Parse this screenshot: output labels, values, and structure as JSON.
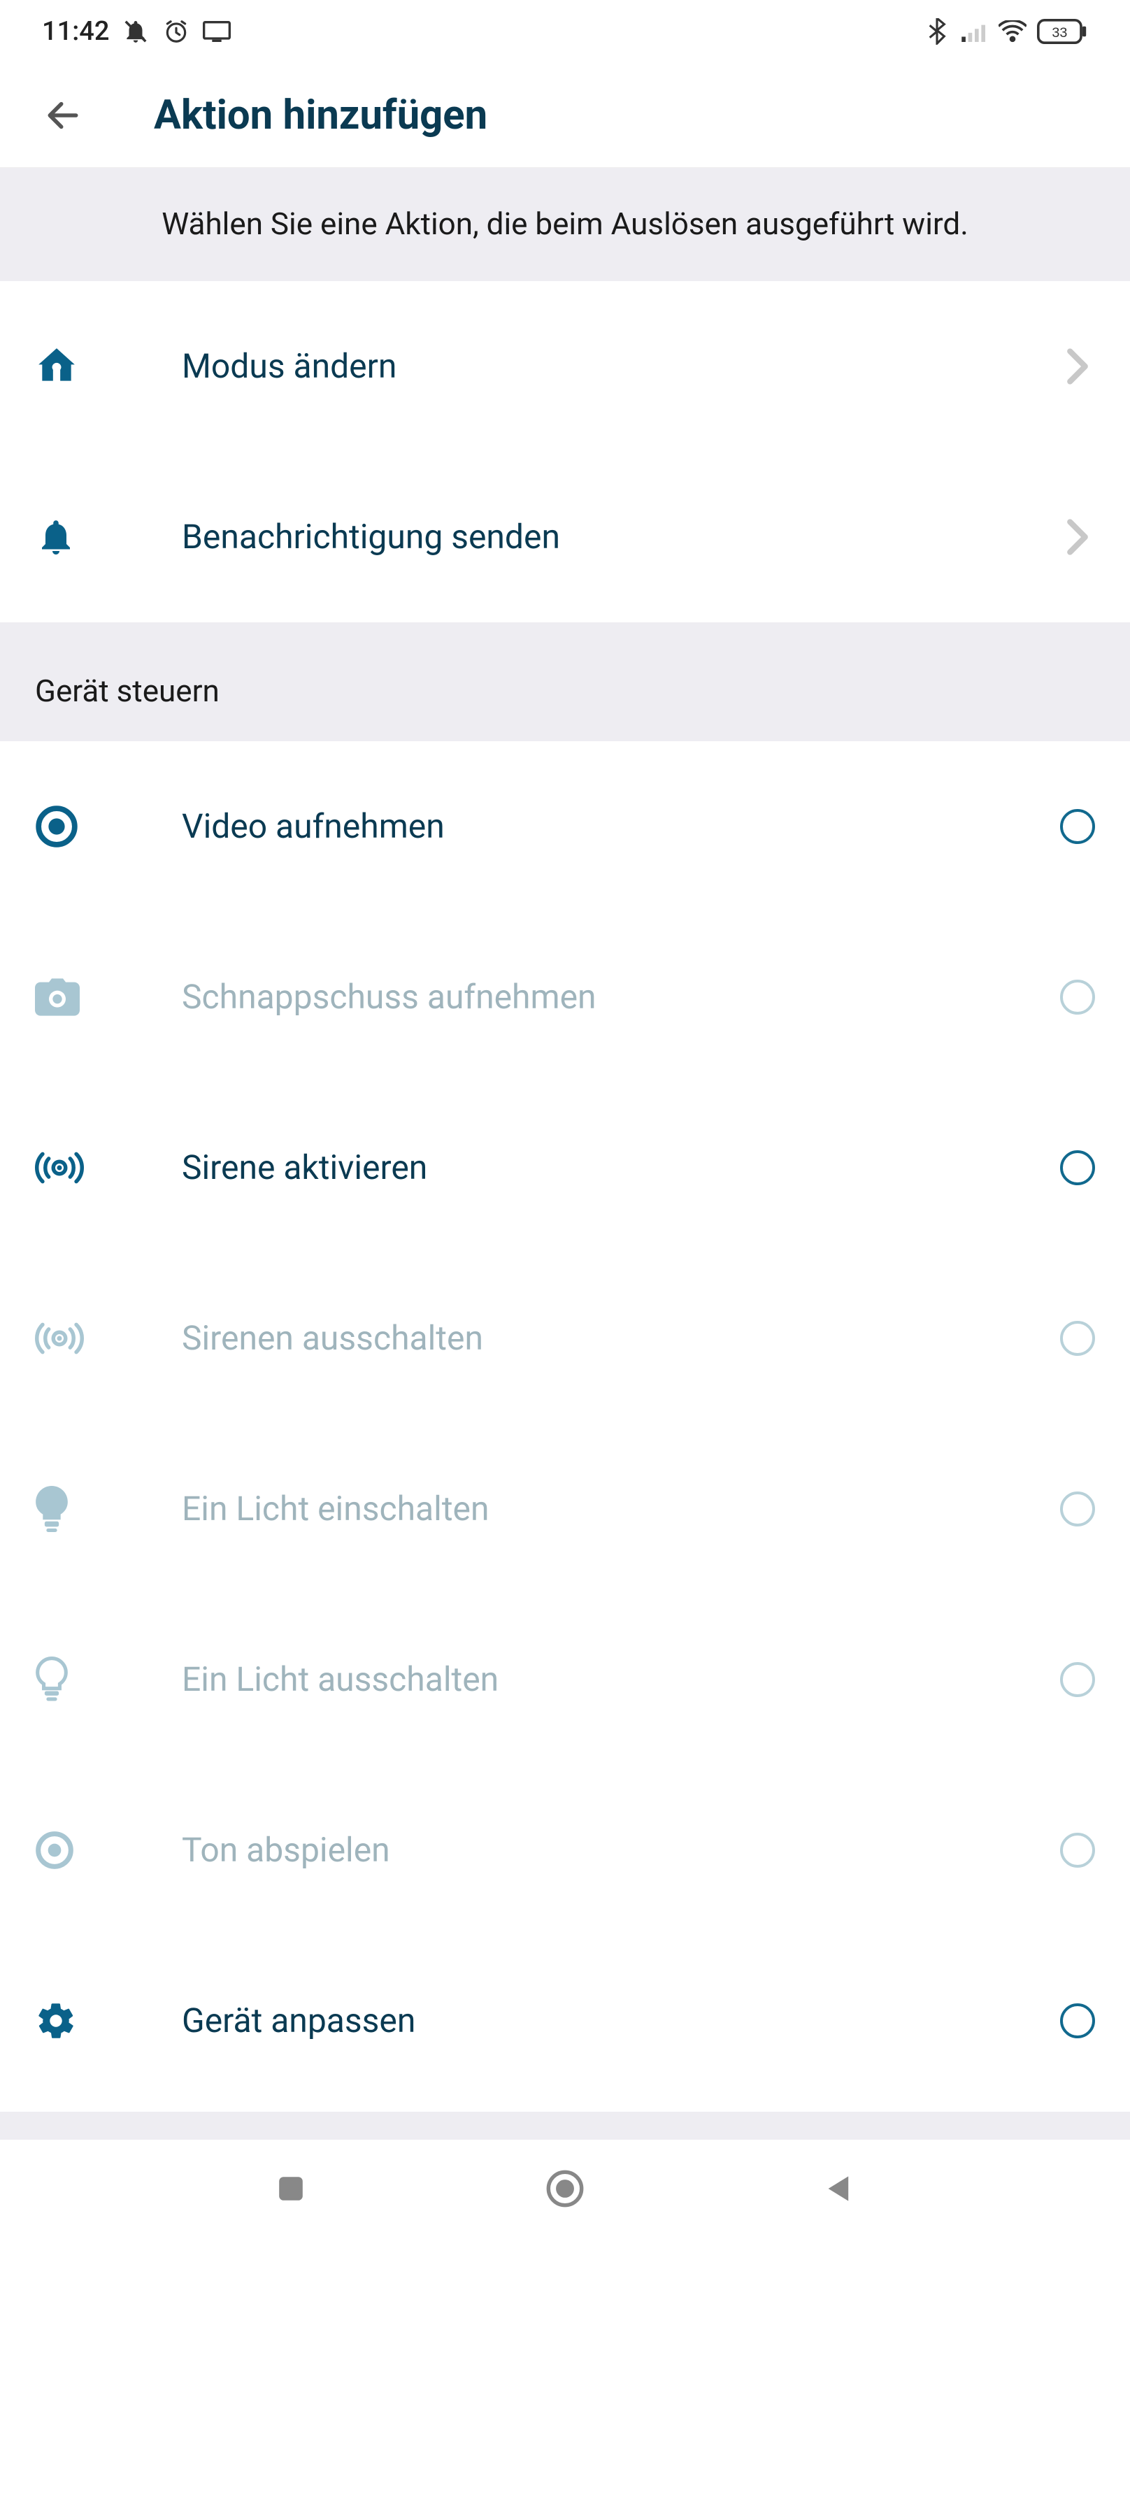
{
  "status": {
    "time": "11:42",
    "battery": "33"
  },
  "header": {
    "title": "Aktion hinzufügen"
  },
  "instruction": "Wählen Sie eine Aktion, die beim Auslösen ausgeführt wird.",
  "top_actions": [
    {
      "icon": "home",
      "label": "Modus ändern"
    },
    {
      "icon": "bell",
      "label": "Benachrichtigung senden"
    }
  ],
  "section_title": "Gerät steuern",
  "device_actions": [
    {
      "icon": "record",
      "label": "Video aufnehmen",
      "disabled": false
    },
    {
      "icon": "camera",
      "label": "Schnappschuss aufnehmen",
      "disabled": true
    },
    {
      "icon": "siren",
      "label": "Sirene aktivieren",
      "disabled": false
    },
    {
      "icon": "siren",
      "label": "Sirenen ausschalten",
      "disabled": true
    },
    {
      "icon": "bulb",
      "label": "Ein Licht einschalten",
      "disabled": true
    },
    {
      "icon": "bulb-outline",
      "label": "Ein Licht ausschalten",
      "disabled": true
    },
    {
      "icon": "dot",
      "label": "Ton abspielen",
      "disabled": true
    },
    {
      "icon": "gear",
      "label": "Gerät anpassen",
      "disabled": false
    }
  ]
}
